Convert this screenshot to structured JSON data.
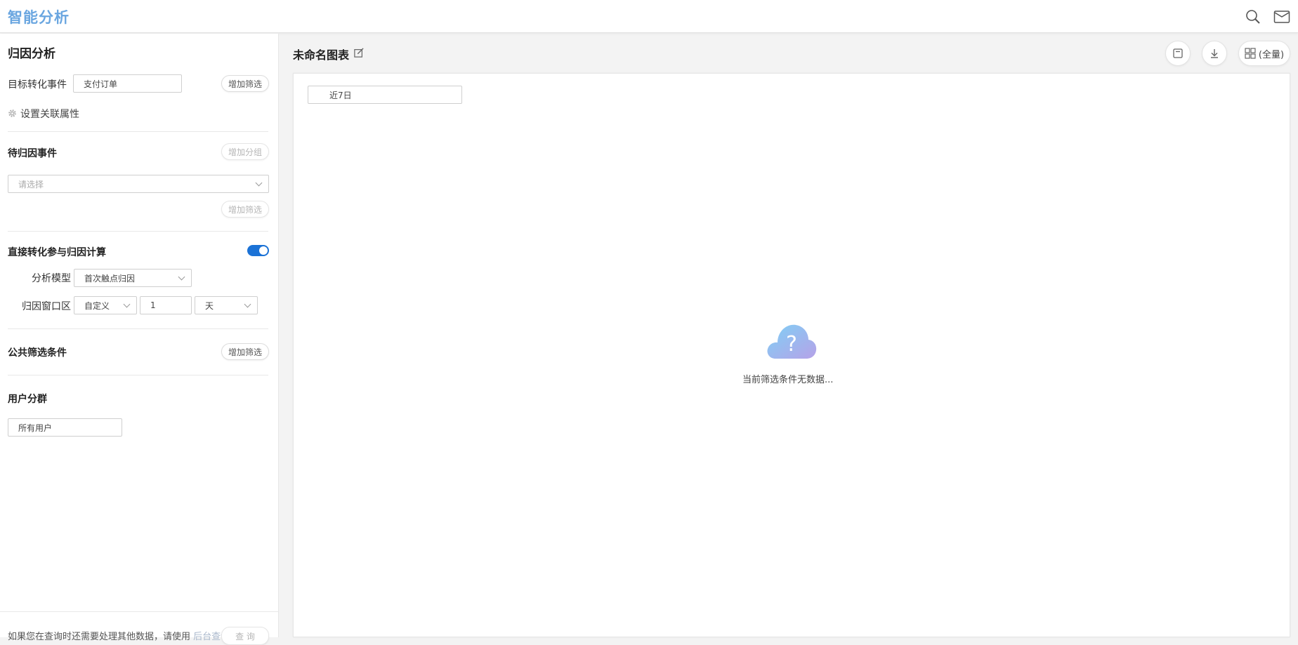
{
  "app": {
    "title": "智能分析"
  },
  "panel": {
    "title": "归因分析",
    "target_event": {
      "label": "目标转化事件",
      "value": "支付订单",
      "add_filter": "增加筛选"
    },
    "related_attr": {
      "label": "设置关联属性"
    },
    "pending": {
      "title": "待归因事件",
      "add_group": "增加分组",
      "placeholder": "请选择",
      "add_filter": "增加筛选"
    },
    "direct": {
      "title": "直接转化参与归因计算",
      "enabled": true
    },
    "model": {
      "label": "分析模型",
      "value": "首次触点归因"
    },
    "window": {
      "label": "归因窗口区",
      "type": "自定义",
      "number": "1",
      "unit": "天"
    },
    "public_filter": {
      "title": "公共筛选条件",
      "add_filter": "增加筛选"
    },
    "segment": {
      "title": "用户分群",
      "value": "所有用户"
    },
    "footer": {
      "note": "如果您在查询时还需要处理其他数据，请使用",
      "link": "后台查询",
      "query_button": "查 询"
    }
  },
  "main": {
    "chart_title": "未命名图表",
    "date_range": "近7日",
    "view_mode": "(全量)",
    "empty_message": "当前筛选条件无数据..."
  },
  "icons": {
    "search": "search-icon",
    "mail": "mail-icon",
    "settings": "gear-icon",
    "edit": "edit-icon",
    "save": "save-icon",
    "download": "download-icon",
    "grid": "grid-icon",
    "empty": "cloud-question-icon"
  },
  "colors": {
    "brand": "#6aa6e0",
    "toggle": "#1b72d6",
    "accent_link": "#aab8cc"
  }
}
